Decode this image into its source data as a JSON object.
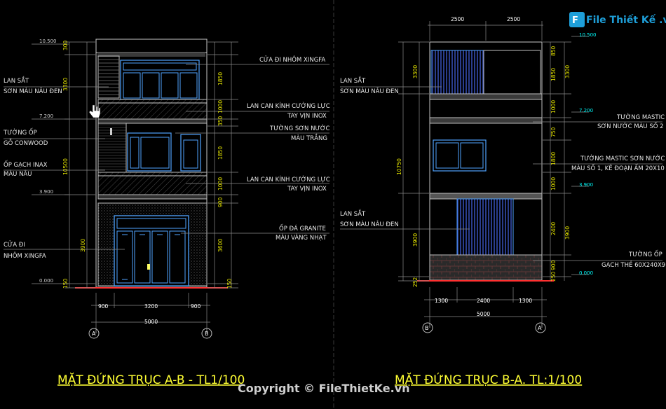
{
  "logo": {
    "text": "File Thiết Kế .vn"
  },
  "copyright": "Copyright © FileThietKe.vn",
  "left": {
    "title": "MẶT ĐỨNG TRỤC A-B - TL1/100",
    "axes": [
      "A",
      "B"
    ],
    "levels": [
      "10.500",
      "7.200",
      "3.900",
      "0.000"
    ],
    "notes_left": [
      {
        "l1": "LAN SẮT",
        "l2": "SƠN MÀU NÂU ĐEN"
      },
      {
        "l1": "TƯỜNG ỐP",
        "l2": "GỖ CONWOOD"
      },
      {
        "l1": "ỐP GẠCH INAX",
        "l2": "MÀU NÂU"
      },
      {
        "l1": "CỬA ĐI",
        "l2": "NHÔM XINGFA"
      }
    ],
    "notes_right": [
      {
        "l1": "CỬA ĐI NHÔM XINGFA",
        "l2": ""
      },
      {
        "l1": "LAN CAN KÍNH CƯỜNG LỰC",
        "l2": "TAY VỊN INOX"
      },
      {
        "l1": "TƯỜNG SƠN NƯỚC",
        "l2": "MÀU TRẮNG"
      },
      {
        "l1": "LAN CAN KÍNH CƯỜNG LỰC",
        "l2": "TAY VỊN INOX"
      },
      {
        "l1": "ỐP ĐÁ GRANITE",
        "l2": "MÀU VÀNG NHẠT"
      }
    ],
    "dims_left": [
      "300",
      "3300",
      "10500",
      "3900",
      "150"
    ],
    "dims_inner": [
      "1850",
      "1000",
      "350",
      "1850",
      "1000",
      "900",
      "3600",
      "150"
    ],
    "dims_bottom": [
      "900",
      "3200",
      "900"
    ],
    "dim_total": "5000"
  },
  "right": {
    "title": "MẶT ĐỨNG TRỤC B-A. TL:1/100",
    "axes": [
      "B",
      "A"
    ],
    "levels": [
      "10.500",
      "7.200",
      "3.900",
      "0.000"
    ],
    "dims_top": [
      "2500",
      "2500"
    ],
    "notes_left": [
      {
        "l1": "LAN SẮT",
        "l2": "SƠN MÀU NÂU ĐEN"
      },
      {
        "l1": "LAN SẮT",
        "l2": "SƠN MÀU NÂU ĐEN"
      }
    ],
    "notes_right": [
      {
        "l1": "TƯỜNG MASTIC",
        "l2": "SƠN NƯỚC MÀU SỐ 2"
      },
      {
        "l1": "TƯỜNG MASTIC SƠN NƯỚC",
        "l2": "MÀU SỐ 1, KẺ ĐOẠN ẤM 20X10"
      },
      {
        "l1": "TƯỜNG ỐP",
        "l2": "GẠCH THẺ 60X240X9"
      }
    ],
    "dims_left": [
      "10750",
      "3900",
      "3300",
      "252"
    ],
    "dims_right": [
      "3300",
      "3900"
    ],
    "dims_inner": [
      "850",
      "1850",
      "1000",
      "750",
      "1800",
      "1000",
      "2400",
      "900",
      "250"
    ],
    "dims_bottom": [
      "1300",
      "2400",
      "1300"
    ],
    "dim_total": "5000"
  }
}
